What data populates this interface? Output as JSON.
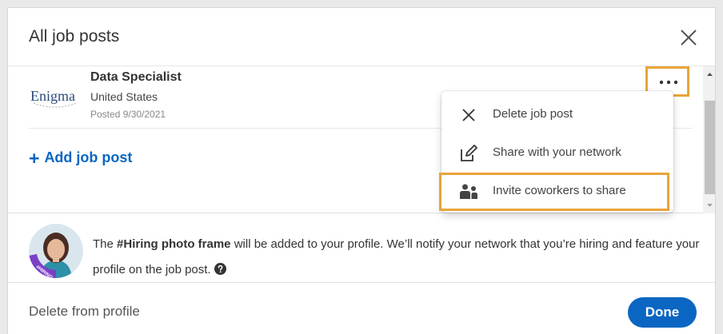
{
  "header": {
    "title": "All job posts"
  },
  "job": {
    "logo_text": "Enigma",
    "title": "Data Specialist",
    "location": "United States",
    "posted": "Posted 9/30/2021"
  },
  "add_job_label": "Add job post",
  "menu": {
    "items": [
      {
        "label": "Delete job post",
        "icon": "close-icon"
      },
      {
        "label": "Share with your network",
        "icon": "edit-share-icon"
      },
      {
        "label": "Invite coworkers to share",
        "icon": "people-icon"
      }
    ]
  },
  "info": {
    "prefix": "The ",
    "bold": "#Hiring photo frame",
    "suffix": " will be added to your profile. We’ll notify your network that you’re hiring and feature your profile on the job post.",
    "avatar_badge": "#HIRING"
  },
  "footer": {
    "delete_label": "Delete from profile",
    "done_label": "Done"
  },
  "colors": {
    "accent": "#0a66c2",
    "highlight": "#e9a43a"
  }
}
